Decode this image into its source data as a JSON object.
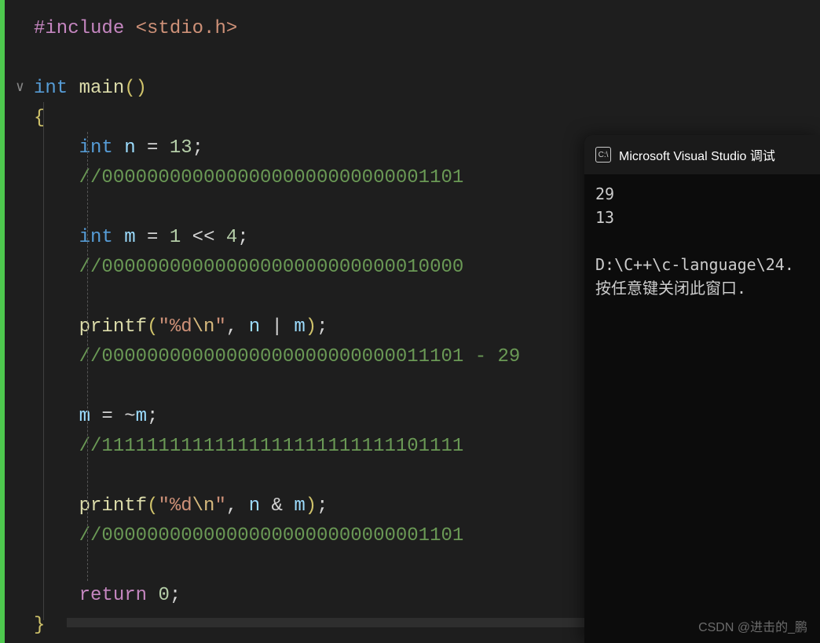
{
  "code": {
    "line1_include": "#include",
    "line1_header": "<stdio.h>",
    "line3_type": "int",
    "line3_func": "main",
    "line5_type": "int",
    "line5_var": "n",
    "line5_num": "13",
    "line6_comment": "//00000000000000000000000000001101",
    "line8_type": "int",
    "line8_var": "m",
    "line8_num1": "1",
    "line8_num2": "4",
    "line9_comment": "//00000000000000000000000000010000",
    "line11_func": "printf",
    "line11_string1": "\"%d",
    "line11_escape": "\\n",
    "line11_string2": "\"",
    "line11_var1": "n",
    "line11_var2": "m",
    "line12_comment": "//00000000000000000000000000011101 - 29",
    "line14_var": "m",
    "line14_var2": "m",
    "line15_comment": "//11111111111111111111111111101111",
    "line17_func": "printf",
    "line17_string1": "\"%d",
    "line17_escape": "\\n",
    "line17_string2": "\"",
    "line17_var1": "n",
    "line17_var2": "m",
    "line18_comment": "//00000000000000000000000000001101",
    "line20_return": "return",
    "line20_num": "0"
  },
  "console": {
    "icon_text": "C:\\",
    "title": "Microsoft Visual Studio 调试",
    "out1": "29",
    "out2": "13",
    "path": "D:\\C++\\c-language\\24.",
    "prompt": "按任意键关闭此窗口. "
  },
  "watermark": "CSDN @进击的_鹏"
}
